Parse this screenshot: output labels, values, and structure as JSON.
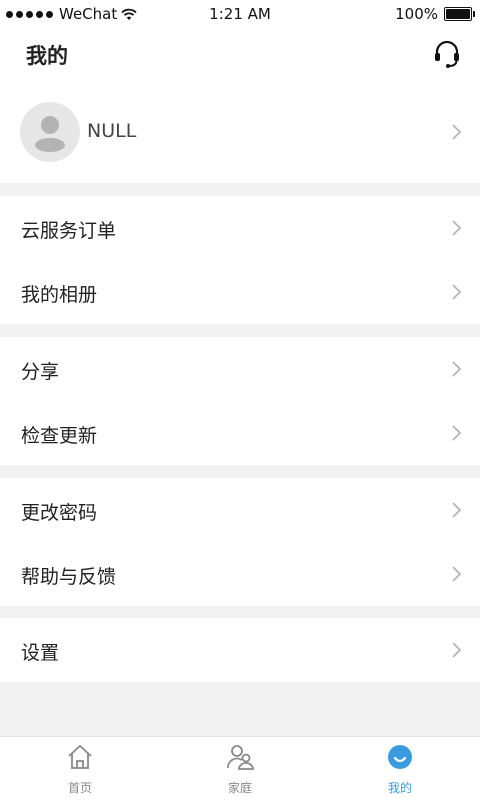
{
  "status_bar": {
    "carrier": "WeChat",
    "time": "1:21 AM",
    "battery": "100%",
    "battery_level": 1.0
  },
  "header": {
    "title": "我的",
    "icon": "headset-icon"
  },
  "profile": {
    "name": "NULL"
  },
  "menu_groups": [
    {
      "items": [
        {
          "label": "云服务订单"
        },
        {
          "label": "我的相册"
        }
      ]
    },
    {
      "items": [
        {
          "label": "分享"
        },
        {
          "label": "检查更新"
        }
      ]
    },
    {
      "items": [
        {
          "label": "更改密码"
        },
        {
          "label": "帮助与反馈"
        }
      ]
    },
    {
      "items": [
        {
          "label": "设置"
        }
      ]
    }
  ],
  "tab_bar": {
    "tabs": [
      {
        "label": "首页",
        "icon": "home-icon",
        "active": false
      },
      {
        "label": "家庭",
        "icon": "family-icon",
        "active": false
      },
      {
        "label": "我的",
        "icon": "profile-icon",
        "active": true
      }
    ],
    "active_color": "#3a9be0"
  }
}
